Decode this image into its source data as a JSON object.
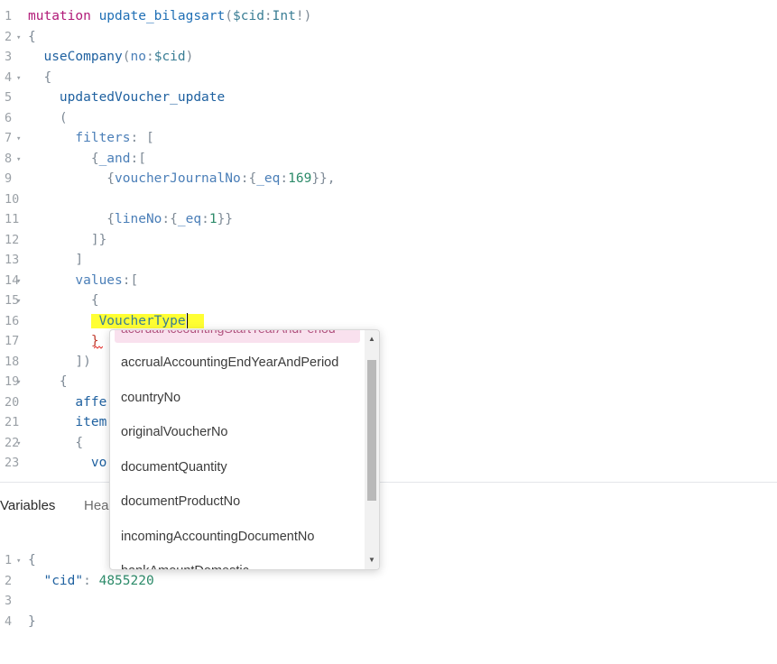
{
  "editor": {
    "lines": [
      {
        "n": "1",
        "fold": "",
        "segs": [
          [
            "kw",
            "mutation "
          ],
          [
            "def",
            "update_bilagsart"
          ],
          [
            "punc",
            "("
          ],
          [
            "var",
            "$cid"
          ],
          [
            "punc",
            ":"
          ],
          [
            "type",
            "Int"
          ],
          [
            "punc",
            "!)"
          ]
        ]
      },
      {
        "n": "2",
        "fold": "▾",
        "segs": [
          [
            "punc",
            "{"
          ]
        ]
      },
      {
        "n": "3",
        "fold": "",
        "segs": [
          [
            "punc",
            "  "
          ],
          [
            "prop",
            "useCompany"
          ],
          [
            "punc",
            "("
          ],
          [
            "arg",
            "no"
          ],
          [
            "punc",
            ":"
          ],
          [
            "var",
            "$cid"
          ],
          [
            "punc",
            ")"
          ]
        ]
      },
      {
        "n": "4",
        "fold": "▾",
        "segs": [
          [
            "punc",
            "  {"
          ]
        ]
      },
      {
        "n": "5",
        "fold": "",
        "segs": [
          [
            "punc",
            "    "
          ],
          [
            "prop",
            "updatedVoucher_update"
          ]
        ]
      },
      {
        "n": "6",
        "fold": "",
        "segs": [
          [
            "punc",
            "    ("
          ]
        ]
      },
      {
        "n": "7",
        "fold": "▾",
        "segs": [
          [
            "punc",
            "      "
          ],
          [
            "arg",
            "filters"
          ],
          [
            "punc",
            ": ["
          ]
        ]
      },
      {
        "n": "8",
        "fold": "▾",
        "segs": [
          [
            "punc",
            "        {"
          ],
          [
            "arg",
            "_and"
          ],
          [
            "punc",
            ":["
          ]
        ]
      },
      {
        "n": "9",
        "fold": "",
        "segs": [
          [
            "punc",
            "          {"
          ],
          [
            "arg",
            "voucherJournalNo"
          ],
          [
            "punc",
            ":{"
          ],
          [
            "arg",
            "_eq"
          ],
          [
            "punc",
            ":"
          ],
          [
            "num",
            "169"
          ],
          [
            "punc",
            "}},"
          ]
        ]
      },
      {
        "n": "10",
        "fold": "",
        "segs": []
      },
      {
        "n": "11",
        "fold": "",
        "segs": [
          [
            "punc",
            "          {"
          ],
          [
            "arg",
            "lineNo"
          ],
          [
            "punc",
            ":{"
          ],
          [
            "arg",
            "_eq"
          ],
          [
            "punc",
            ":"
          ],
          [
            "num",
            "1"
          ],
          [
            "punc",
            "}}"
          ]
        ]
      },
      {
        "n": "12",
        "fold": "",
        "segs": [
          [
            "punc",
            "        ]}"
          ]
        ]
      },
      {
        "n": "13",
        "fold": "",
        "segs": [
          [
            "punc",
            "      ]"
          ]
        ]
      },
      {
        "n": "14",
        "fold": "▾",
        "segs": [
          [
            "punc",
            "      "
          ],
          [
            "arg",
            "values"
          ],
          [
            "punc",
            ":["
          ]
        ]
      },
      {
        "n": "15",
        "fold": "▾",
        "segs": [
          [
            "punc",
            "        {"
          ]
        ]
      },
      {
        "n": "16",
        "fold": "",
        "segs": [
          [
            "punc",
            "        "
          ],
          [
            "hl",
            " VoucherType"
          ],
          [
            "cursor",
            ""
          ],
          [
            "hl",
            "  "
          ]
        ]
      },
      {
        "n": "17",
        "fold": "",
        "segs": [
          [
            "punc",
            "        "
          ],
          [
            "str",
            "}"
          ]
        ]
      },
      {
        "n": "18",
        "fold": "",
        "segs": [
          [
            "punc",
            "      ])"
          ]
        ]
      },
      {
        "n": "19",
        "fold": "▾",
        "segs": [
          [
            "punc",
            "    {"
          ]
        ]
      },
      {
        "n": "20",
        "fold": "",
        "segs": [
          [
            "punc",
            "      "
          ],
          [
            "prop",
            "affe"
          ]
        ]
      },
      {
        "n": "21",
        "fold": "",
        "segs": [
          [
            "punc",
            "      "
          ],
          [
            "prop",
            "item"
          ]
        ]
      },
      {
        "n": "22",
        "fold": "▾",
        "segs": [
          [
            "punc",
            "      {"
          ]
        ]
      },
      {
        "n": "23",
        "fold": "",
        "segs": [
          [
            "punc",
            "        "
          ],
          [
            "prop",
            "vo"
          ]
        ]
      }
    ]
  },
  "bottom_tabs": {
    "variables": "Variables",
    "headers": "Hea"
  },
  "variables": {
    "lines": [
      {
        "n": "1",
        "fold": "▾",
        "segs": [
          [
            "punc",
            "{"
          ]
        ]
      },
      {
        "n": "2",
        "fold": "",
        "segs": [
          [
            "punc",
            "  "
          ],
          [
            "prop",
            "\"cid\""
          ],
          [
            "punc",
            ": "
          ],
          [
            "num",
            "4855220"
          ]
        ]
      },
      {
        "n": "3",
        "fold": "",
        "segs": []
      },
      {
        "n": "4",
        "fold": "",
        "segs": [
          [
            "punc",
            "}"
          ]
        ]
      }
    ]
  },
  "autocomplete": {
    "partial_top_item": "accrualAccountingStartYearAndPeriod",
    "items": [
      "accrualAccountingEndYearAndPeriod",
      "countryNo",
      "originalVoucherNo",
      "documentQuantity",
      "documentProductNo",
      "incomingAccountingDocumentNo",
      "bankAmountDomestic"
    ]
  }
}
